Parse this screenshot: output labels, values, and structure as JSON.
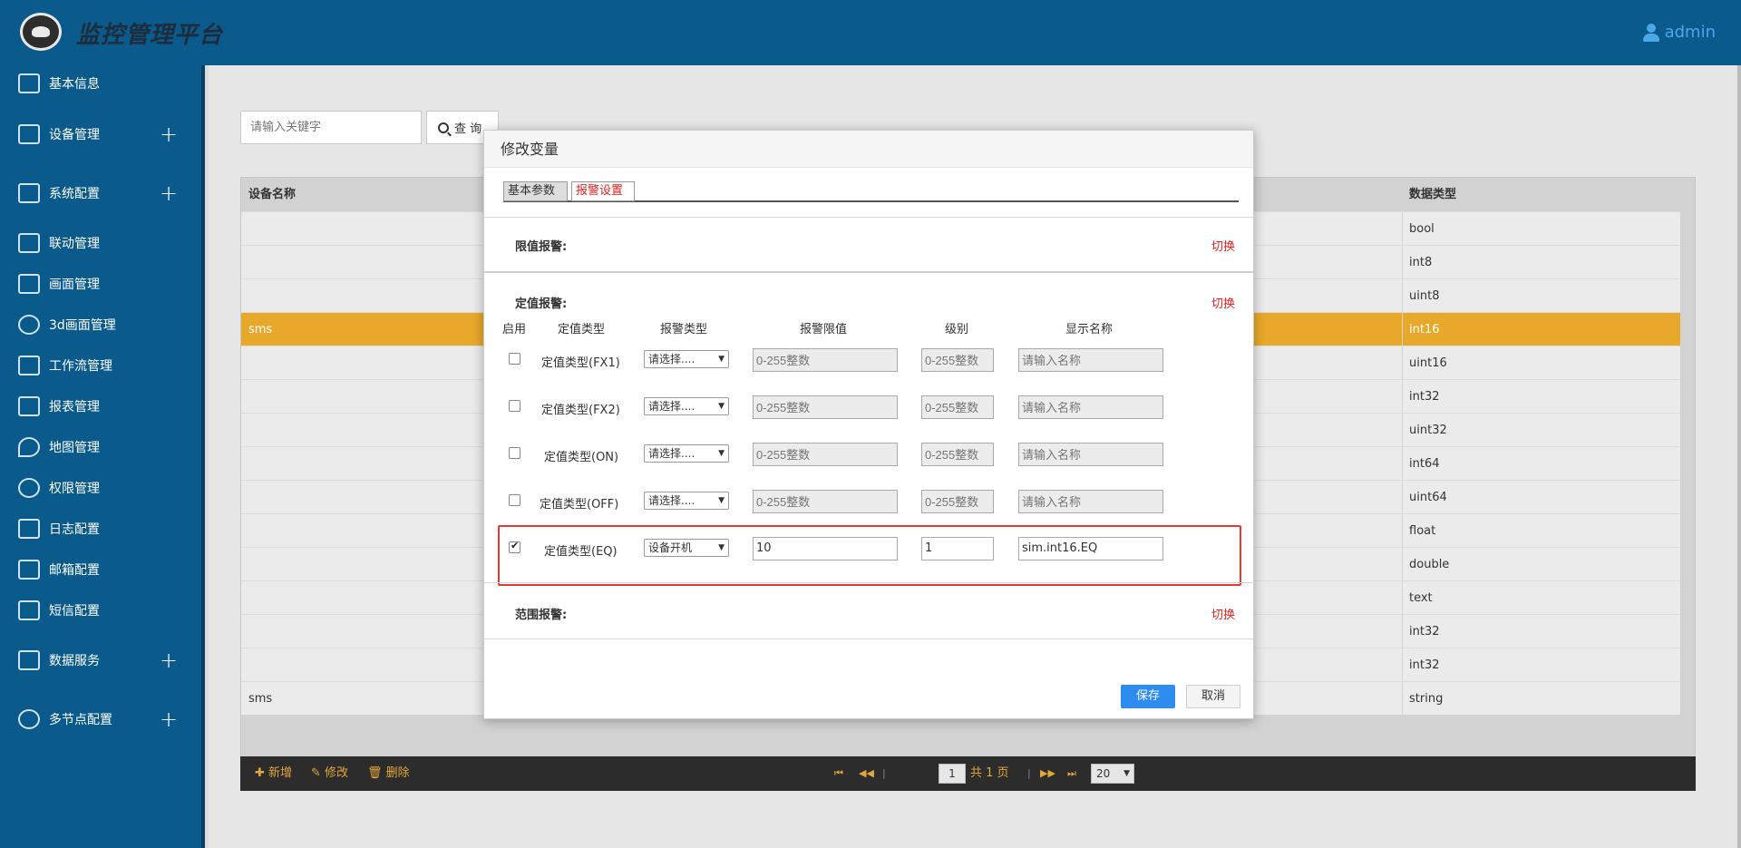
{
  "header": {
    "title": "监控管理平台",
    "user": "admin"
  },
  "sidebar": {
    "items": [
      {
        "label": "基本信息",
        "icon": "clipboard-icon",
        "expandable": false
      },
      {
        "label": "设备管理",
        "icon": "monitor-pulse-icon",
        "expandable": true
      },
      {
        "label": "系统配置",
        "icon": "sliders-icon",
        "expandable": true
      },
      {
        "label": "联动管理",
        "icon": "link-doc-icon",
        "expandable": false
      },
      {
        "label": "画面管理",
        "icon": "image-icon",
        "expandable": false
      },
      {
        "label": "3d画面管理",
        "icon": "3d-icon",
        "expandable": false
      },
      {
        "label": "工作流管理",
        "icon": "workflow-icon",
        "expandable": false
      },
      {
        "label": "报表管理",
        "icon": "report-icon",
        "expandable": false
      },
      {
        "label": "地图管理",
        "icon": "map-pin-icon",
        "expandable": false
      },
      {
        "label": "权限管理",
        "icon": "user-lock-icon",
        "expandable": false
      },
      {
        "label": "日志配置",
        "icon": "log-icon",
        "expandable": false
      },
      {
        "label": "邮箱配置",
        "icon": "mail-icon",
        "expandable": false
      },
      {
        "label": "短信配置",
        "icon": "sms-icon",
        "expandable": false
      },
      {
        "label": "数据服务",
        "icon": "chart-icon",
        "expandable": true
      },
      {
        "label": "多节点配置",
        "icon": "nodes-icon",
        "expandable": true
      }
    ],
    "plus": "+"
  },
  "search": {
    "placeholder": "请输入关键字",
    "button": "查 询"
  },
  "table": {
    "headers": {
      "device": "设备名称",
      "datatype": "数据类型"
    },
    "rows": [
      {
        "device": "",
        "datatype": "bool",
        "selected": false
      },
      {
        "device": "",
        "datatype": "int8",
        "selected": false
      },
      {
        "device": "",
        "datatype": "uint8",
        "selected": false
      },
      {
        "device": "sms",
        "datatype": "int16",
        "selected": true
      },
      {
        "device": "",
        "datatype": "uint16",
        "selected": false
      },
      {
        "device": "",
        "datatype": "int32",
        "selected": false
      },
      {
        "device": "",
        "datatype": "uint32",
        "selected": false
      },
      {
        "device": "",
        "datatype": "int64",
        "selected": false
      },
      {
        "device": "",
        "datatype": "uint64",
        "selected": false
      },
      {
        "device": "",
        "datatype": "float",
        "selected": false
      },
      {
        "device": "",
        "datatype": "double",
        "selected": false
      },
      {
        "device": "",
        "datatype": "text",
        "selected": false
      },
      {
        "device": "",
        "datatype": "int32",
        "selected": false
      },
      {
        "device": "",
        "datatype": "int32",
        "selected": false
      },
      {
        "device": "sms",
        "datatype": "string",
        "selected": false
      }
    ]
  },
  "toolbar": {
    "add": "新增",
    "edit": "修改",
    "delete": "删除"
  },
  "pager": {
    "current": "1",
    "total_text": "共 1 页",
    "page_size": "20"
  },
  "modal": {
    "title": "修改变量",
    "tabs": {
      "basic": "基本参数",
      "alarm": "报警设置"
    },
    "limit_section": "限值报警:",
    "fixed_section": "定值报警:",
    "range_section": "范围报警:",
    "switch": "切换",
    "columns": {
      "enable": "启用",
      "type": "定值类型",
      "alarm_type": "报警类型",
      "limit": "报警限值",
      "level": "级别",
      "display_name": "显示名称"
    },
    "rows": [
      {
        "enabled": false,
        "type": "定值类型(FX1)",
        "alarm_type": "请选择....",
        "limit": "",
        "limit_placeholder": "0-255整数",
        "level": "",
        "level_placeholder": "0-255整数",
        "name": "",
        "name_placeholder": "请输入名称"
      },
      {
        "enabled": false,
        "type": "定值类型(FX2)",
        "alarm_type": "请选择....",
        "limit": "",
        "limit_placeholder": "0-255整数",
        "level": "",
        "level_placeholder": "0-255整数",
        "name": "",
        "name_placeholder": "请输入名称"
      },
      {
        "enabled": false,
        "type": "定值类型(ON)",
        "alarm_type": "请选择....",
        "limit": "",
        "limit_placeholder": "0-255整数",
        "level": "",
        "level_placeholder": "0-255整数",
        "name": "",
        "name_placeholder": "请输入名称"
      },
      {
        "enabled": false,
        "type": "定值类型(OFF)",
        "alarm_type": "请选择....",
        "limit": "",
        "limit_placeholder": "0-255整数",
        "level": "",
        "level_placeholder": "0-255整数",
        "name": "",
        "name_placeholder": "请输入名称"
      },
      {
        "enabled": true,
        "type": "定值类型(EQ)",
        "alarm_type": "设备开机",
        "limit": "10",
        "limit_placeholder": "0-255整数",
        "level": "1",
        "level_placeholder": "0-255整数",
        "name": "sim.int16.EQ",
        "name_placeholder": "请输入名称"
      }
    ],
    "save": "保存",
    "cancel": "取消"
  },
  "colors": {
    "header_bg": "#0a5a8c",
    "selected_row": "#e8a92a",
    "accent_red": "#e02020",
    "save_blue": "#2d8cf0"
  }
}
